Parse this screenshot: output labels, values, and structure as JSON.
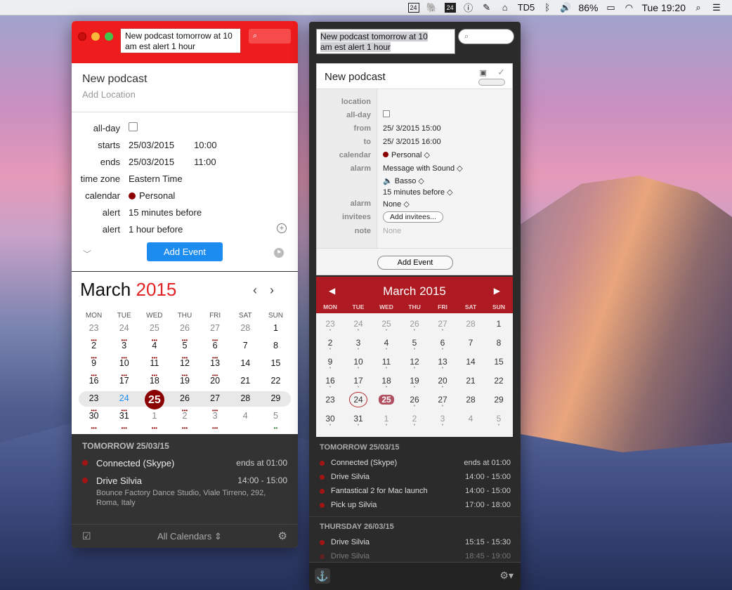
{
  "menubar": {
    "icons": [
      "24",
      "evernote-icon",
      "24",
      "info-icon",
      "pen-icon",
      "home-icon"
    ],
    "td_label": "TD5",
    "battery": "86%",
    "clock": "Tue 19:20"
  },
  "left": {
    "input": "New podcast tomorrow at 10 am est alert 1 hour",
    "search_placeholder": "",
    "title": "New podcast",
    "location_placeholder": "Add Location",
    "labels": {
      "allday": "all-day",
      "starts": "starts",
      "ends": "ends",
      "timezone": "time zone",
      "calendar": "calendar",
      "alert1": "alert",
      "alert2": "alert"
    },
    "starts_date": "25/03/2015",
    "starts_time": "10:00",
    "ends_date": "25/03/2015",
    "ends_time": "11:00",
    "timezone": "Eastern Time",
    "calendar": "Personal",
    "alert1": "15 minutes before",
    "alert2": "1 hour before",
    "add_event": "Add Event",
    "month": "March",
    "year": "2015",
    "weekdays": [
      "MON",
      "TUE",
      "WED",
      "THU",
      "FRI",
      "SAT",
      "SUN"
    ],
    "weeks": [
      [
        "23",
        "24",
        "25",
        "26",
        "27",
        "28",
        "1"
      ],
      [
        "2",
        "3",
        "4",
        "5",
        "6",
        "7",
        "8"
      ],
      [
        "9",
        "10",
        "11",
        "12",
        "13",
        "14",
        "15"
      ],
      [
        "16",
        "17",
        "18",
        "19",
        "20",
        "21",
        "22"
      ],
      [
        "23",
        "24",
        "25",
        "26",
        "27",
        "28",
        "29"
      ],
      [
        "30",
        "31",
        "1",
        "2",
        "3",
        "4",
        "5"
      ]
    ],
    "events_header": "TOMORROW 25/03/15",
    "events": [
      {
        "name": "Connected (Skype)",
        "time": "ends at 01:00"
      },
      {
        "name": "Drive Silvia",
        "time": "14:00 - 15:00"
      }
    ],
    "event_sub": "Bounce Factory Dance Studio, Viale Tirreno, 292, Roma, Italy",
    "footer_cal": "All Calendars ⇕"
  },
  "right": {
    "input_line1": "New podcast tomorrow at 10",
    "input_line2": "am est alert 1 hour",
    "title": "New podcast",
    "labels": {
      "location": "location",
      "allday": "all-day",
      "from": "from",
      "to": "to",
      "calendar": "calendar",
      "alarm": "alarm",
      "alarm2": "alarm",
      "invitees": "invitees",
      "note": "note"
    },
    "from": "25/  3/2015 15:00",
    "to": "25/  3/2015 16:00",
    "calendar": "Personal ◇",
    "alarm_type": "Message with Sound ◇",
    "alarm_sound": "🔈 Basso ◇",
    "alarm_time": "15  minutes before ◇",
    "alarm2": "None ◇",
    "invitees_button": "Add invitees...",
    "note_placeholder": "None",
    "add_event": "Add Event",
    "month_title": "March 2015",
    "weekdays": [
      "MON",
      "TUE",
      "WED",
      "THU",
      "FRI",
      "SAT",
      "SUN"
    ],
    "weeks": [
      [
        "23",
        "24",
        "25",
        "26",
        "27",
        "28",
        "1"
      ],
      [
        "2",
        "3",
        "4",
        "5",
        "6",
        "7",
        "8"
      ],
      [
        "9",
        "10",
        "11",
        "12",
        "13",
        "14",
        "15"
      ],
      [
        "16",
        "17",
        "18",
        "19",
        "20",
        "21",
        "22"
      ],
      [
        "23",
        "24",
        "25",
        "26",
        "27",
        "28",
        "29"
      ],
      [
        "30",
        "31",
        "1",
        "2",
        "3",
        "4",
        "5"
      ]
    ],
    "section1": "TOMORROW 25/03/15",
    "events1": [
      {
        "name": "Connected (Skype)",
        "time": "ends at 01:00"
      },
      {
        "name": "Drive Silvia",
        "time": "14:00 - 15:00"
      },
      {
        "name": "Fantastical 2 for Mac launch",
        "time": "14:00 - 15:00"
      },
      {
        "name": "Pick up Silvia",
        "time": "17:00 - 18:00"
      }
    ],
    "section2": "THURSDAY 26/03/15",
    "events2": [
      {
        "name": "Drive Silvia",
        "time": "15:15 - 15:30"
      },
      {
        "name": "Drive Silvia",
        "time": "18:45 - 19:00"
      }
    ]
  }
}
